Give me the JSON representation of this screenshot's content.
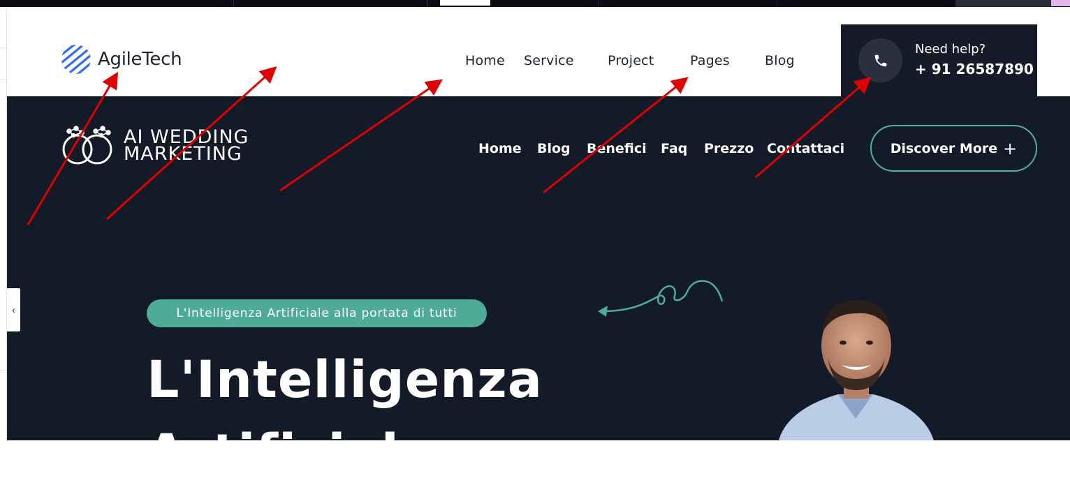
{
  "header_top": {
    "brand": "AgileTech",
    "nav": [
      "Home",
      "Service",
      "Project",
      "Pages",
      "Blog"
    ],
    "help_label": "Need help?",
    "help_phone": "+ 91 26587890"
  },
  "hero": {
    "brand_line1": "AI WEDDING",
    "brand_line2": "MARKETING",
    "nav": [
      "Home",
      "Blog",
      "Benefici",
      "Faq",
      "Prezzo",
      "Contattaci"
    ],
    "cta_label": "Discover More",
    "cta_icon": "+",
    "tag": "L'Intelligenza Artificiale alla portata di tutti",
    "headline_line1": "L'Intelligenza",
    "headline_line2": "Artificiale",
    "slider_prev": "‹"
  },
  "colors": {
    "dark_bg": "#131a28",
    "accent_green": "#4eab95",
    "help_bg": "#151b28",
    "logo_blue": "#2f6bf0",
    "annotation_red": "#e00000"
  },
  "icons": [
    "phone-icon",
    "agiletech-logo-icon",
    "wedding-rings-icon",
    "plus-icon",
    "chevron-left-icon",
    "squiggle-arrow-icon"
  ]
}
